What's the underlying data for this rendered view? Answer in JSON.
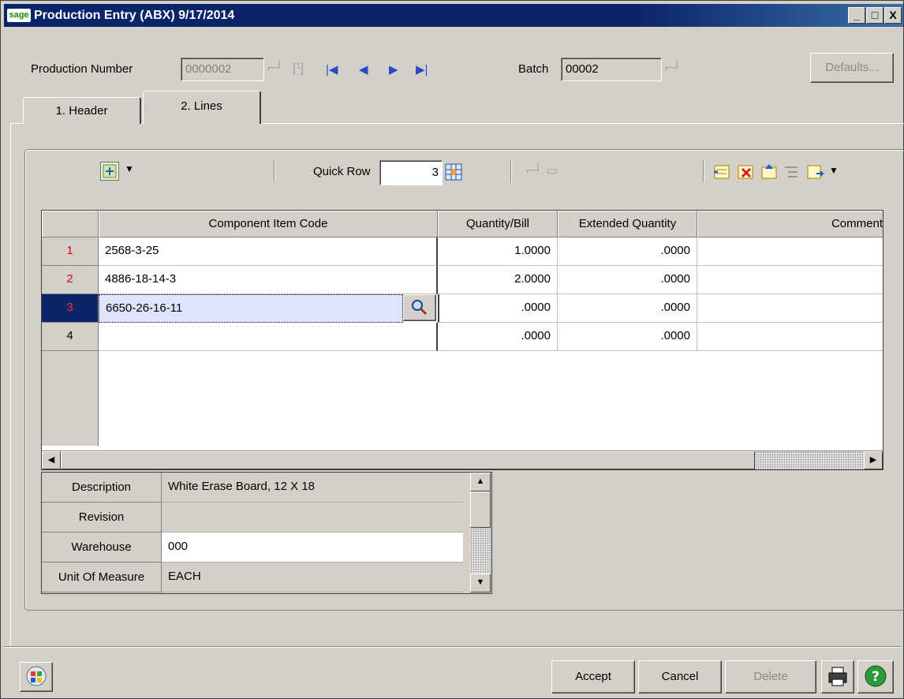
{
  "window": {
    "logo": "sage",
    "title": "Production Entry (ABX) 9/17/2014",
    "controls": [
      "_",
      "□",
      "X"
    ]
  },
  "header": {
    "production_number_label": "Production Number",
    "production_number_value": "0000002",
    "batch_label": "Batch",
    "batch_value": "00002",
    "defaults_label": "Defaults..."
  },
  "tabs": [
    {
      "label": "1. Header"
    },
    {
      "label": "2. Lines"
    }
  ],
  "toolbar": {
    "quick_row_label": "Quick Row",
    "quick_row_value": "3"
  },
  "grid": {
    "columns": [
      "Component Item Code",
      "Quantity/Bill",
      "Extended Quantity",
      "Comment"
    ],
    "rows": [
      {
        "num": "1",
        "item": "2568-3-25",
        "qty": "1.0000",
        "ext": ".0000",
        "comment": ""
      },
      {
        "num": "2",
        "item": "4886-18-14-3",
        "qty": "2.0000",
        "ext": ".0000",
        "comment": ""
      },
      {
        "num": "3",
        "item": "6650-26-16-11",
        "qty": ".0000",
        "ext": ".0000",
        "comment": ""
      },
      {
        "num": "4",
        "item": "",
        "qty": ".0000",
        "ext": ".0000",
        "comment": ""
      }
    ]
  },
  "details": {
    "description_label": "Description",
    "description_value": "White Erase Board, 12 X 18",
    "revision_label": "Revision",
    "revision_value": "",
    "warehouse_label": "Warehouse",
    "warehouse_value": "000",
    "uom_label": "Unit Of Measure",
    "uom_value": "EACH"
  },
  "footer": {
    "accept_label": "Accept",
    "cancel_label": "Cancel",
    "delete_label": "Delete"
  },
  "colors": {
    "titlebar": "#0a246a",
    "selected_row_header": "#0a246a",
    "row_number_red": "#e00000",
    "selected_cell": "#dfe4fb"
  }
}
